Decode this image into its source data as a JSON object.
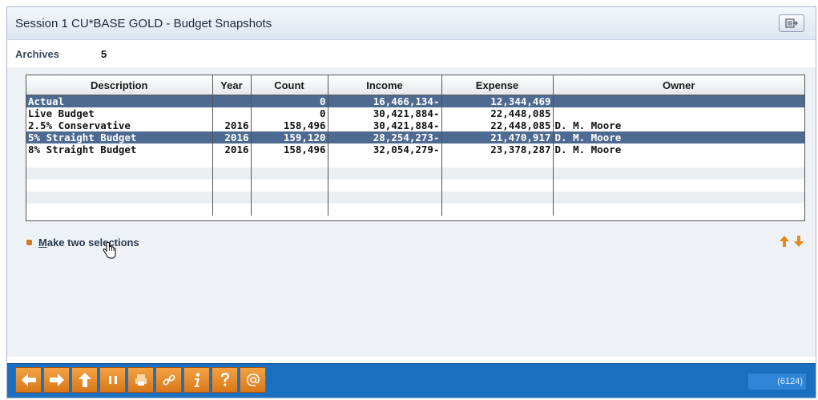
{
  "window": {
    "title": "Session 1 CU*BASE GOLD - Budget Snapshots"
  },
  "archives": {
    "label": "Archives",
    "value": "5"
  },
  "grid": {
    "columns": [
      "Description",
      "Year",
      "Count",
      "Income",
      "Expense",
      "Owner"
    ],
    "rows": [
      {
        "description": "Actual",
        "year": "",
        "count": "0",
        "income": "16,466,134-",
        "expense": "12,344,469",
        "owner": "",
        "selected": true
      },
      {
        "description": "Live Budget",
        "year": "",
        "count": "0",
        "income": "30,421,884-",
        "expense": "22,448,085",
        "owner": "",
        "selected": false
      },
      {
        "description": "2.5% Conservative",
        "year": "2016",
        "count": "158,496",
        "income": "30,421,884-",
        "expense": "22,448,085",
        "owner": "D. M. Moore",
        "selected": false
      },
      {
        "description": "5% Straight Budget",
        "year": "2016",
        "count": "159,120",
        "income": "28,254,273-",
        "expense": "21,470,917",
        "owner": "D. M. Moore",
        "selected": true
      },
      {
        "description": "8% Straight Budget",
        "year": "2016",
        "count": "158,496",
        "income": "32,054,279-",
        "expense": "23,378,287",
        "owner": "D. M. Moore",
        "selected": false
      }
    ]
  },
  "actions": {
    "make_two_selections_label": "ake two selections",
    "make_two_selections_mnemonic": "M"
  },
  "footer": {
    "status_code": "(6124)"
  },
  "colors": {
    "accent_orange": "#e8891f",
    "footer_blue": "#1a6fc1",
    "selection": "#4e6a91"
  }
}
